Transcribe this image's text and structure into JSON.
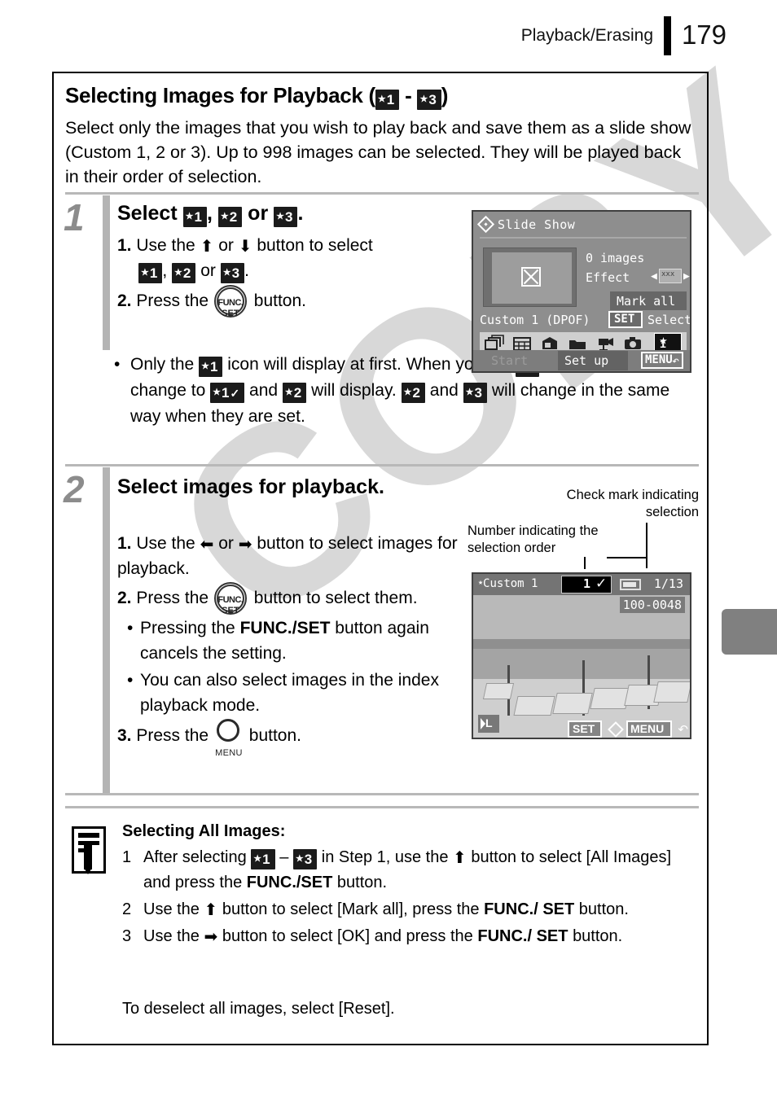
{
  "header": {
    "section_title": "Playback/Erasing",
    "page_number": "179"
  },
  "section": {
    "title_prefix": "Selecting Images for Playback (",
    "title_sep": "-",
    "title_suffix": ")",
    "intro": "Select only the images that you wish to play back and save them as a slide show (Custom 1, 2 or 3). Up to 998 images can be selected. They will be played back in their order of selection."
  },
  "icons": {
    "star": "★",
    "check": "✓",
    "custom1": "1",
    "custom2": "2",
    "custom3": "3",
    "arrow_up": "⬆",
    "arrow_down": "⬇",
    "arrow_left": "⬅",
    "arrow_right": "➡",
    "func_top": "FUNC.",
    "func_bottom": "SET",
    "menu_label": "MENU"
  },
  "step1": {
    "number": "1",
    "heading_a": "Select",
    "heading_b": ",",
    "heading_c": "or",
    "heading_d": ".",
    "item1_a": "1.",
    "item1_b": "Use the",
    "item1_c": "or",
    "item1_d": "button to select",
    "item1_e": ",",
    "item1_f": "or",
    "item1_g": ".",
    "item2_a": "2.",
    "item2_b": "Press the",
    "item2_c": "button.",
    "bullet_a": "Only the",
    "bullet_b": "icon will display at first. When you set",
    "bullet_c": ", the icon will change to",
    "bullet_d": "and",
    "bullet_e": "will display.",
    "bullet_f": "and",
    "bullet_g": "will change in the same way when they are set."
  },
  "lcd_slideshow": {
    "title": "Slide Show",
    "images_count": "0 images",
    "effect_label": "Effect",
    "effect_value": "xxx",
    "mark_all": "Mark all",
    "custom_label": "Custom 1 (DPOF)",
    "set_label": "SET",
    "select_label": "Select",
    "start_label": "Start",
    "setup_label": "Set up",
    "menu_label": "MENU",
    "return_glyph": "↶",
    "selected_tab": "1",
    "tab_icons": [
      "stacked-images-icon",
      "calendar-grid-icon",
      "photo-box-icon",
      "folder-icon",
      "movie-camera-icon",
      "still-camera-icon",
      "custom1-badge-icon"
    ]
  },
  "step2": {
    "number": "2",
    "heading": "Select images for playback.",
    "item1_a": "1.",
    "item1_b": "Use the",
    "item1_c": "or",
    "item1_d": "button to select images for playback.",
    "item2_a": "2.",
    "item2_b": "Press the",
    "item2_c": "button to select them.",
    "sub1_a": "Pressing the",
    "sub1_b": "FUNC./SET",
    "sub1_c": "button again cancels the setting.",
    "sub2": "You can also select images in the index playback mode.",
    "item3_a": "3.",
    "item3_b": "Press the",
    "item3_c": "button."
  },
  "callouts": {
    "check_mark": "Check mark indicating selection",
    "number_order": "Number indicating the selection order"
  },
  "lcd_photo": {
    "custom_label": "Custom 1",
    "star_prefix": "★",
    "order_number": "1",
    "check_glyph": "✓",
    "frame_count": "1/13",
    "file_number": "100-0048",
    "quality": "L",
    "set_label": "SET",
    "menu_label": "MENU",
    "return_glyph": "↶",
    "scene": "beach with lounge chairs and umbrellas"
  },
  "note": {
    "title": "Selecting All Images:",
    "item1_num": "1",
    "item1_a": "After selecting",
    "item1_b": "–",
    "item1_c": "in Step 1, use the",
    "item1_d": "button to select [All Images] and press the",
    "item1_e": "FUNC./SET",
    "item1_f": "button.",
    "item2_num": "2",
    "item2_a": "Use the",
    "item2_b": "button to select [Mark all], press the",
    "item2_c": "FUNC./",
    "item2_d": "SET",
    "item2_e": "button.",
    "item3_num": "3",
    "item3_a": "Use the",
    "item3_b": "button to select [OK] and press the",
    "item3_c": "FUNC./",
    "item3_d": "SET",
    "item3_e": "button.",
    "final": "To deselect all images, select [Reset]."
  },
  "watermark": {
    "text": "COPY"
  },
  "colors": {
    "step_number_gray": "#8c8c8c",
    "divider_gray": "#b8b8b8",
    "tab_gray": "#808080",
    "lcd_gray": "#8e8e8e",
    "badge_black": "#1b1b1b"
  }
}
